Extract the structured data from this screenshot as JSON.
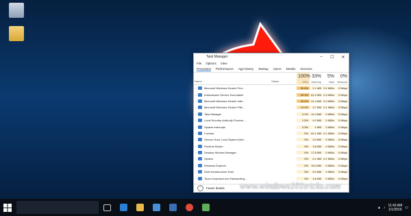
{
  "window": {
    "title": "Task Manager",
    "controls": [
      "–",
      "☐",
      "✕"
    ]
  },
  "menu": [
    "File",
    "Options",
    "View"
  ],
  "tabs": [
    "Processes",
    "Performance",
    "App history",
    "Startup",
    "Users",
    "Details",
    "Services"
  ],
  "columns": {
    "name": "Name",
    "status": "Status",
    "cpu_pct": "100%",
    "cpu": "CPU",
    "memory_pct": "33%",
    "memory": "Memory",
    "disk_pct": "5%",
    "disk": "Disk",
    "network_pct": "0%",
    "network": "Network"
  },
  "rows": [
    {
      "name": "Microsoft Windows Search Prot...",
      "cpu": "30.6%",
      "memory": "2.1 MB",
      "disk": "3.2 MB/s",
      "network": "0 Mbps",
      "heat": "hot"
    },
    {
      "name": "Antimalware Service Executable",
      "cpu": "25.3%",
      "memory": "81.0 MB",
      "disk": "0.4 MB/s",
      "network": "0 Mbps",
      "heat": "hot"
    },
    {
      "name": "Microsoft Windows Search Inde...",
      "cpu": "25.0%",
      "memory": "41.4 MB",
      "disk": "0.4 MB/s",
      "network": "0 Mbps",
      "heat": "hot"
    },
    {
      "name": "Microsoft Windows Search Filte...",
      "cpu": "14.4%",
      "memory": "3.7 MB",
      "disk": "0.1 MB/s",
      "network": "0 Mbps",
      "heat": "warm"
    },
    {
      "name": "Task Manager",
      "cpu": "2.1%",
      "memory": "10.4 MB",
      "disk": "0 MB/s",
      "network": "0 Mbps",
      "heat": ""
    },
    {
      "name": "Local Security Authority Process...",
      "cpu": "1.5%",
      "memory": "4.0 MB",
      "disk": "0 MB/s",
      "network": "0 Mbps",
      "heat": ""
    },
    {
      "name": "System interrupts",
      "cpu": "0.3%",
      "memory": "0 MB",
      "disk": "0 MB/s",
      "network": "0 Mbps",
      "heat": ""
    },
    {
      "name": "Cortana",
      "cpu": "0%",
      "memory": "52.1 MB",
      "disk": "0.1 MB/s",
      "network": "0 Mbps",
      "heat": ""
    },
    {
      "name": "Service Host: Local System (Net...",
      "cpu": "0%",
      "memory": "3.0 MB",
      "disk": "0 MB/s",
      "network": "0 Mbps",
      "heat": ""
    },
    {
      "name": "Runtime Broker",
      "cpu": "0%",
      "memory": "3.8 MB",
      "disk": "0 MB/s",
      "network": "0 Mbps",
      "heat": ""
    },
    {
      "name": "Desktop Window Manager",
      "cpu": "0%",
      "memory": "17.8 MB",
      "disk": "0 MB/s",
      "network": "0 Mbps",
      "heat": ""
    },
    {
      "name": "System",
      "cpu": "0%",
      "memory": "0.1 MB",
      "disk": "0.1 MB/s",
      "network": "0 Mbps",
      "heat": ""
    },
    {
      "name": "Windows Explorer",
      "cpu": "0%",
      "memory": "15.0 MB",
      "disk": "0 MB/s",
      "network": "0 Mbps",
      "heat": ""
    },
    {
      "name": "Shell Infrastructure Host",
      "cpu": "0%",
      "memory": "5.0 MB",
      "disk": "0 MB/s",
      "network": "0 Mbps",
      "heat": ""
    },
    {
      "name": "Touch Keyboard and Handwriting ...",
      "cpu": "0%",
      "memory": "3.6 MB",
      "disk": "0 MB/s",
      "network": "0 Mbps",
      "heat": ""
    }
  ],
  "footer": {
    "label": "Fewer details"
  },
  "watermark": "www.windows101tricks.com",
  "taskbar": {
    "time": "11:43 AM",
    "date": "1/1/2016"
  },
  "colors": {
    "arrow": "#ff1a10",
    "cpu_hot": "#f8c978",
    "accent": "#2a7bd3"
  }
}
